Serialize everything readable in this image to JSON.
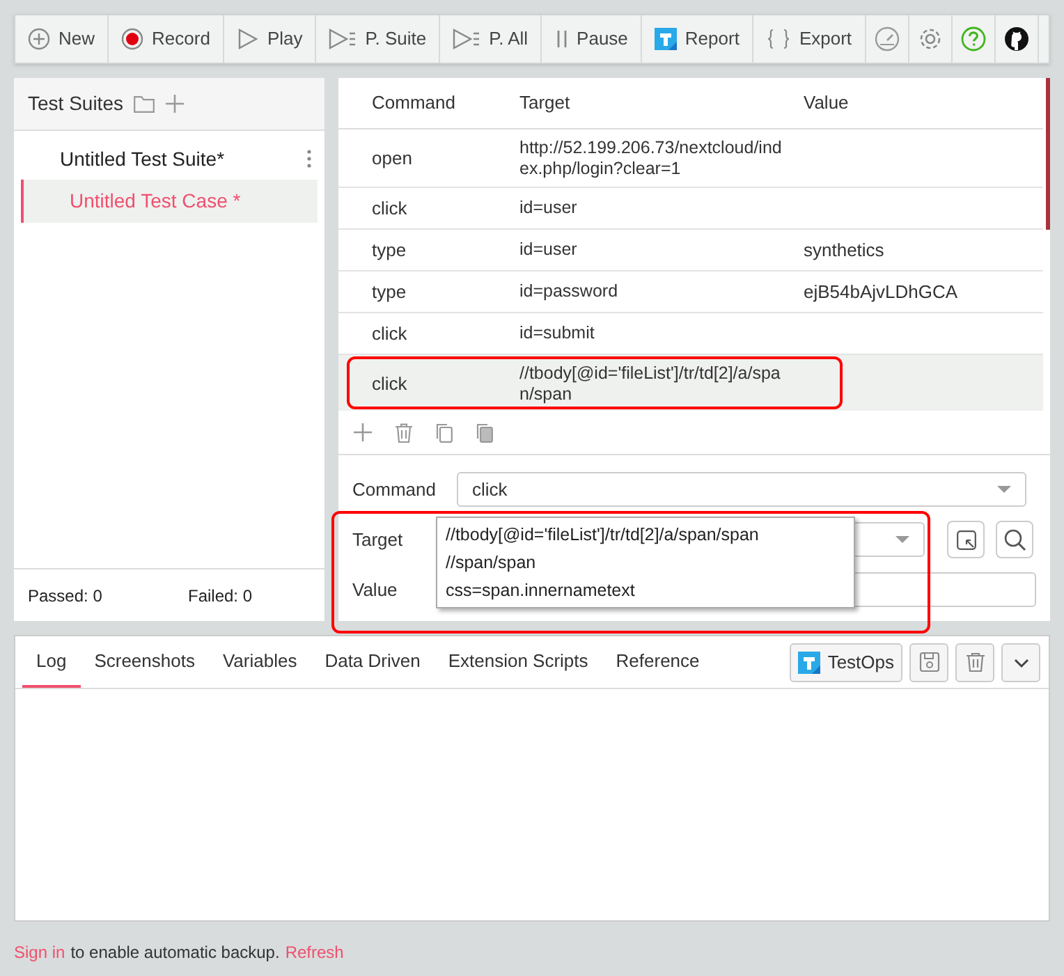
{
  "toolbar": [
    {
      "kind": "new",
      "label": "New"
    },
    {
      "kind": "record",
      "label": "Record"
    },
    {
      "kind": "play",
      "label": "Play"
    },
    {
      "kind": "suite",
      "label": "P. Suite"
    },
    {
      "kind": "all",
      "label": "P. All"
    },
    {
      "kind": "pause",
      "label": "Pause"
    },
    {
      "kind": "report",
      "label": "Report"
    },
    {
      "kind": "export",
      "label": "Export"
    },
    {
      "kind": "speed"
    },
    {
      "kind": "settings"
    },
    {
      "kind": "help"
    },
    {
      "kind": "github"
    }
  ],
  "sidebar": {
    "title": "Test Suites",
    "suites": [
      {
        "name": "Untitled Test Suite*",
        "cases": [
          {
            "name": "Untitled Test Case *",
            "selected": true
          }
        ]
      }
    ],
    "passed": "Passed: 0",
    "failed": "Failed: 0"
  },
  "table": {
    "columns": [
      "Command",
      "Target",
      "Value"
    ],
    "rows": [
      {
        "command": "open",
        "target": "http://52.199.206.73/nextcloud/index.php/login?clear=1",
        "value": "",
        "selected": false,
        "highlighted": false
      },
      {
        "command": "click",
        "target": "id=user",
        "value": "",
        "selected": false,
        "highlighted": false
      },
      {
        "command": "type",
        "target": "id=user",
        "value": "synthetics",
        "selected": false,
        "highlighted": false
      },
      {
        "command": "type",
        "target": "id=password",
        "value": "ejB54bAjvLDhGCA",
        "selected": false,
        "highlighted": false
      },
      {
        "command": "click",
        "target": "id=submit",
        "value": "",
        "selected": false,
        "highlighted": false
      },
      {
        "command": "click",
        "target": "//tbody[@id='fileList']/tr/td[2]/a/span/span",
        "value": "",
        "selected": true,
        "highlighted": true
      }
    ]
  },
  "editor": {
    "command_label": "Command",
    "command": "click",
    "target_label": "Target",
    "value_label": "Value",
    "highlighted": true,
    "target_suggestions": [
      "//tbody[@id='fileList']/tr/td[2]/a/span/span",
      "//span/span",
      "css=span.innernametext"
    ]
  },
  "bottom_tabs": [
    {
      "label": "Log",
      "selected": true
    },
    {
      "label": "Screenshots",
      "selected": false
    },
    {
      "label": "Variables",
      "selected": false
    },
    {
      "label": "Data Driven",
      "selected": false
    },
    {
      "label": "Extension Scripts",
      "selected": false
    },
    {
      "label": "Reference",
      "selected": false
    }
  ],
  "testops_button": "TestOps",
  "footer": {
    "sign_in": "Sign in",
    "message": "to enable automatic backup.",
    "refresh": "Refresh"
  }
}
